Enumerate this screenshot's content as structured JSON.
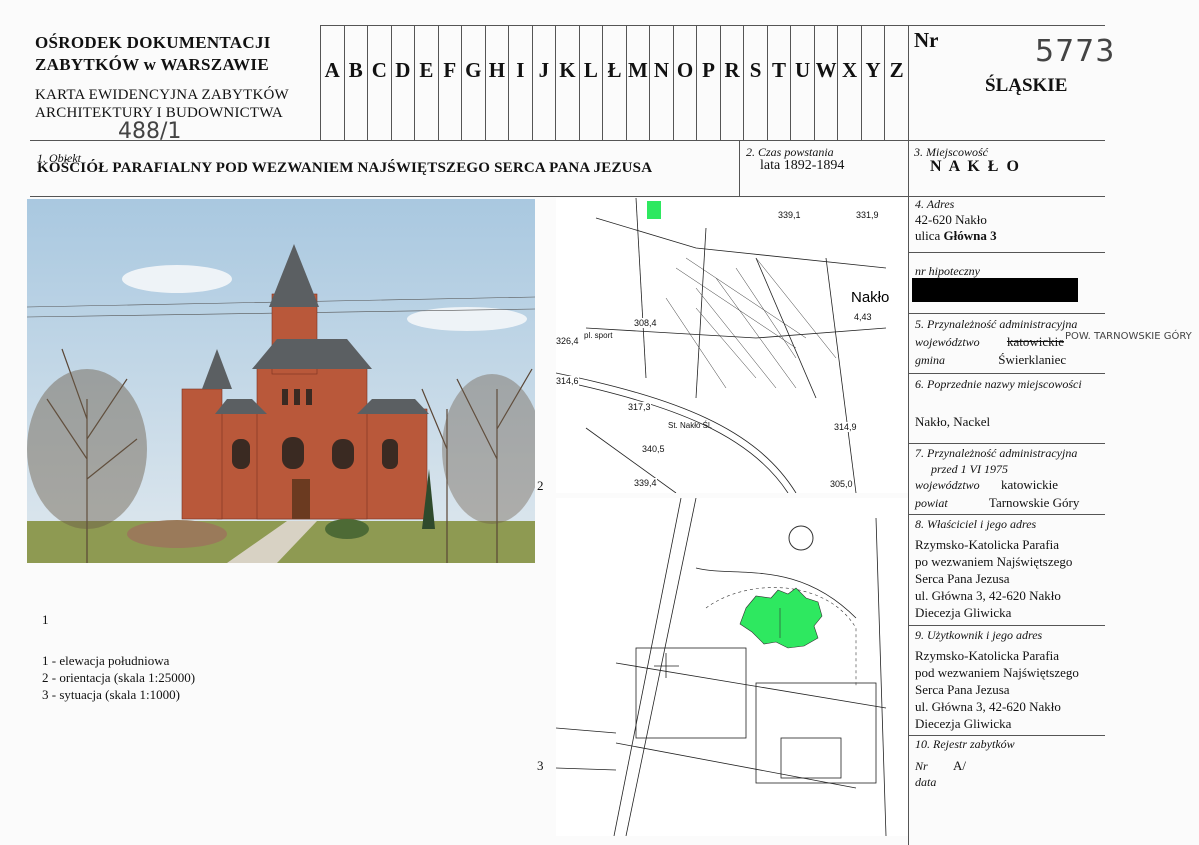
{
  "header": {
    "institution_line1": "OŚRODEK DOKUMENTACJI",
    "institution_line2": "ZABYTKÓW w WARSZAWIE",
    "card_title_line1": "KARTA EWIDENCYJNA ZABYTKÓW",
    "card_title_line2": "ARCHITEKTURY I BUDOWNICTWA",
    "handwritten_ref": "488/1",
    "letters": [
      "A",
      "B",
      "C",
      "D",
      "E",
      "F",
      "G",
      "H",
      "I",
      "J",
      "K",
      "L",
      "Ł",
      "M",
      "N",
      "O",
      "P",
      "R",
      "S",
      "T",
      "U",
      "W",
      "X",
      "Y",
      "Z"
    ],
    "nr_label": "Nr",
    "nr_value": "5773",
    "region": "ŚLĄSKIE"
  },
  "fields": {
    "object_label": "1. Obiekt",
    "object_value": "KOŚCIÓŁ PARAFIALNY POD WEZWANIEM NAJŚWIĘTSZEGO SERCA PANA JEZUSA",
    "date_label": "2. Czas powstania",
    "date_value": "lata 1892-1894",
    "place_label": "3. Miejscowość",
    "place_value": "N A K Ł O"
  },
  "sidebar": {
    "address_label": "4. Adres",
    "address_line1": "42-620 Nakło",
    "address_line2_prefix": "ulica",
    "address_line2_value": "Główna 3",
    "hypo_label": "nr hipoteczny",
    "admin_label": "5. Przynależność administracyjna",
    "voiv_label": "województwo",
    "voiv_value_struck": "katowickie",
    "voiv_handwritten": "POW. TARNOWSKIE GÓRY",
    "gmina_label": "gmina",
    "gmina_value": "Świerklaniec",
    "prev_names_label": "6. Poprzednie nazwy miejscowości",
    "prev_names_value": "Nakło, Nackel",
    "admin1975_label1": "7. Przynależność administracyjna",
    "admin1975_label2": "przed 1 VI 1975",
    "voiv1975_label": "województwo",
    "voiv1975_value": "katowickie",
    "powiat_label": "powiat",
    "powiat_value": "Tarnowskie Góry",
    "owner_label": "8. Właściciel i jego adres",
    "owner_lines": [
      "Rzymsko-Katolicka Parafia",
      "po wezwaniem Najświętszego",
      "Serca Pana Jezusa",
      "ul. Główna 3, 42-620 Nakło",
      "Diecezja Gliwicka"
    ],
    "user_label": "9. Użytkownik i jego adres",
    "user_lines": [
      "Rzymsko-Katolicka Parafia",
      "pod wezwaniem Najświętszego",
      "Serca Pana Jezusa",
      "ul. Główna 3, 42-620 Nakło",
      "Diecezja Gliwicka"
    ],
    "register_label": "10. Rejestr zabytków",
    "reg_nr_label": "Nr",
    "reg_nr_value": "A/",
    "reg_date_label": "data"
  },
  "legend": {
    "marker": "1",
    "items": [
      "1 - elewacja południowa",
      "2 - orientacja (skala 1:25000)",
      "3 - sytuacja (skala 1:1000)"
    ],
    "map2_number": "2",
    "map3_number": "3"
  },
  "map_labels": {
    "town": "Nakło",
    "heights": [
      "339,1",
      "331,9",
      "308,4",
      "326,4",
      "314,6",
      "317,3",
      "314,9",
      "340,5",
      "339,4",
      "305,0",
      "4,43"
    ],
    "sport": "pl. sport",
    "station": "St. Nakło Śl."
  },
  "colors": {
    "highlight": "#2ee860",
    "redaction": "#000000",
    "rule": "#555555"
  }
}
